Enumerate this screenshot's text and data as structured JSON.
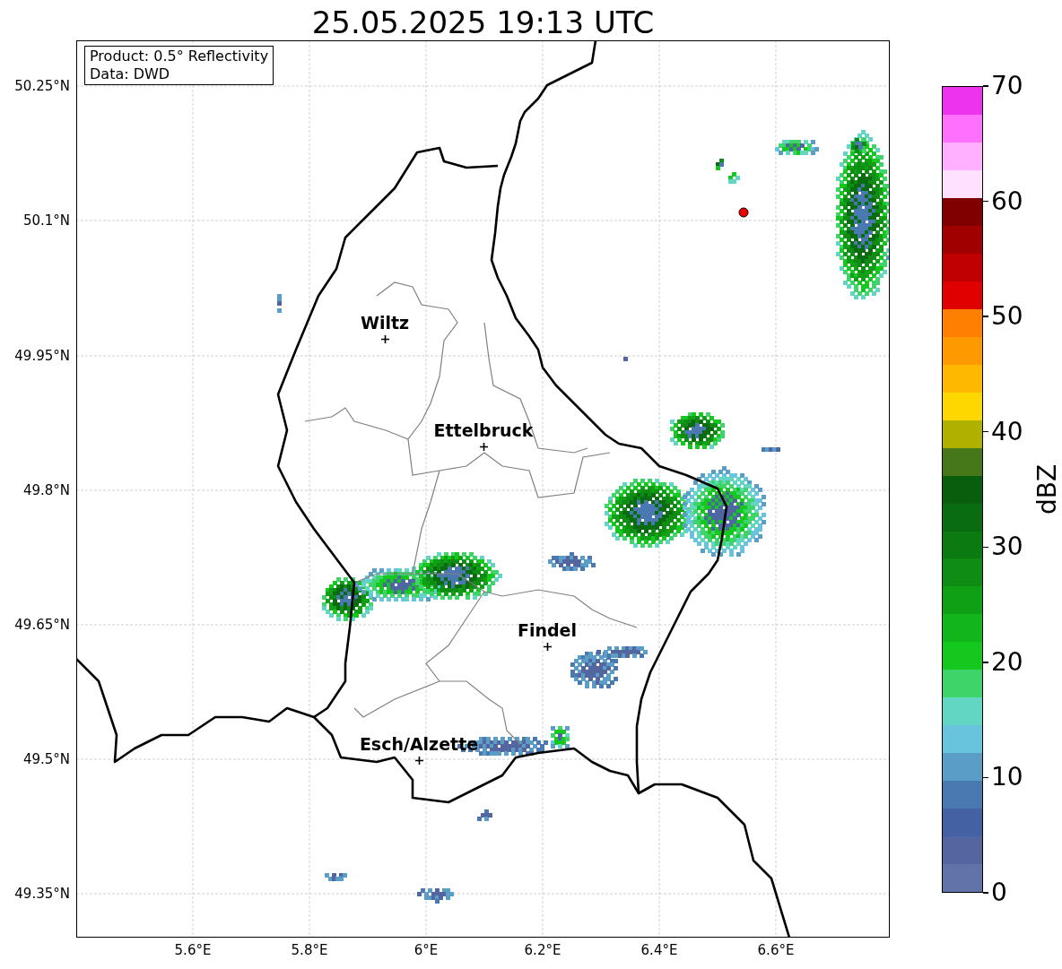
{
  "title": "25.05.2025 19:13 UTC",
  "info_box": [
    "Product: 0.5° Reflectivity",
    "Data: DWD"
  ],
  "map": {
    "lat_labels": [
      "50.25°N",
      "50.1°N",
      "49.95°N",
      "49.8°N",
      "49.65°N",
      "49.5°N",
      "49.35°N"
    ],
    "lon_labels": [
      "5.6°E",
      "5.8°E",
      "6°E",
      "6.2°E",
      "6.4°E",
      "6.6°E"
    ],
    "cities": [
      "Wiltz",
      "Ettelbruck",
      "Findel",
      "Esch/Alzette"
    ]
  },
  "colorbar": {
    "ticks": [
      "70",
      "60",
      "50",
      "40",
      "30",
      "20",
      "10",
      "0"
    ],
    "label": "dBZ",
    "segments": [
      {
        "color": "#ee33ee"
      },
      {
        "color": "#ff70ff"
      },
      {
        "color": "#ffb0ff"
      },
      {
        "color": "#ffe0ff"
      },
      {
        "color": "#800000"
      },
      {
        "color": "#a00000"
      },
      {
        "color": "#c00000"
      },
      {
        "color": "#e00000"
      },
      {
        "color": "#ff7f00"
      },
      {
        "color": "#ff9900"
      },
      {
        "color": "#ffb800"
      },
      {
        "color": "#ffd700"
      },
      {
        "color": "#b0b000"
      },
      {
        "color": "#46781a"
      },
      {
        "color": "#085e0c"
      },
      {
        "color": "#0a6c10"
      },
      {
        "color": "#0b7a10"
      },
      {
        "color": "#0e8c14"
      },
      {
        "color": "#10a016"
      },
      {
        "color": "#12b51a"
      },
      {
        "color": "#14c81e"
      },
      {
        "color": "#3fd46a"
      },
      {
        "color": "#62d6c2"
      },
      {
        "color": "#68c3dc"
      },
      {
        "color": "#5a9ec8"
      },
      {
        "color": "#4a78b0"
      },
      {
        "color": "#4361a3"
      },
      {
        "color": "#53669f"
      },
      {
        "color": "#6173a8"
      }
    ]
  }
}
